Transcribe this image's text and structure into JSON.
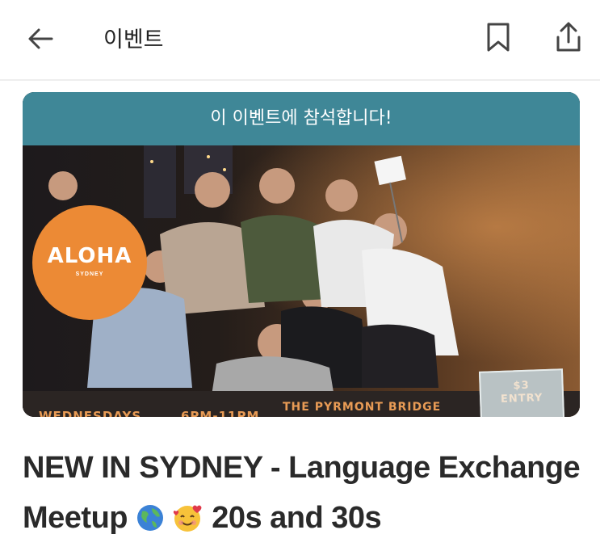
{
  "header": {
    "title": "이벤트",
    "icons": {
      "back": "arrow-left-icon",
      "bookmark": "bookmark-icon",
      "share": "share-icon"
    }
  },
  "event_card": {
    "attend_banner": "이 이벤트에 참석합니다!",
    "banner_color": "#3f8797",
    "logo_text": "ALOHA",
    "logo_sub": "SYDNEY",
    "logo_color": "#ec8a35",
    "strip": {
      "days": "WEDNESDAYS",
      "time": "6PM-11PM",
      "venue": "THE PYRMONT BRIDGE"
    },
    "entry_badge": {
      "price": "$3",
      "label": "ENTRY"
    }
  },
  "event": {
    "title_part1": "NEW IN SYDNEY - Language Exchange Meetup",
    "title_part2": "20s and 30s",
    "emoji": [
      "globe-icon",
      "smiling-face-with-hearts-icon"
    ]
  }
}
